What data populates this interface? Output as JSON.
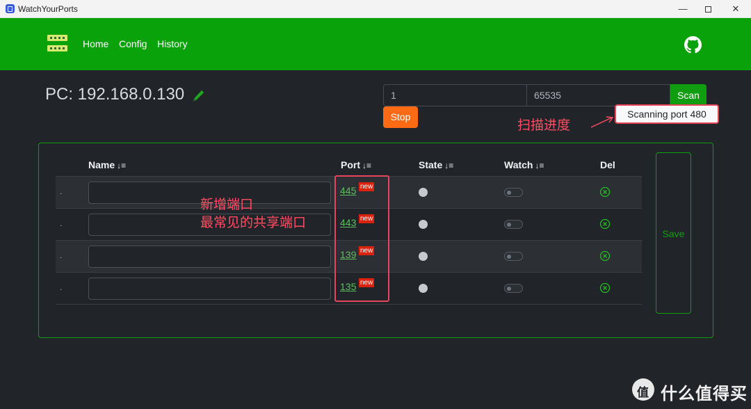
{
  "window": {
    "title": "WatchYourPorts",
    "controls": {
      "minimize": "—",
      "maximize": "",
      "close": "✕"
    }
  },
  "nav": {
    "links": [
      "Home",
      "Config",
      "History"
    ],
    "github_icon": "github-icon"
  },
  "pc": {
    "title": "PC: 192.168.0.130",
    "edit_icon": "pencil-icon"
  },
  "scan": {
    "start_value": "1",
    "end_value": "65535",
    "scan_label": "Scan",
    "stop_label": "Stop",
    "status": "Scanning port 480"
  },
  "annotations": {
    "progress": "扫描进度",
    "new_ports_line1": "新增端口",
    "new_ports_line2": "最常见的共享端口"
  },
  "table": {
    "headers": {
      "name": "Name",
      "port": "Port",
      "state": "State",
      "watch": "Watch",
      "del": "Del"
    },
    "sort_glyph": "↓≡",
    "rows": [
      {
        "marker": ".",
        "name": "",
        "port": "445",
        "badge": "new",
        "state": "off",
        "watch": false
      },
      {
        "marker": ".",
        "name": "",
        "port": "443",
        "badge": "new",
        "state": "off",
        "watch": false
      },
      {
        "marker": ".",
        "name": "",
        "port": "139",
        "badge": "new",
        "state": "off",
        "watch": false
      },
      {
        "marker": ".",
        "name": "",
        "port": "135",
        "badge": "new",
        "state": "off",
        "watch": false
      }
    ],
    "save_label": "Save"
  },
  "watermark": {
    "text": "什么值得买"
  },
  "colors": {
    "nav": "#0aa20a",
    "accent": "#109e10",
    "stop": "#fd6a14",
    "annotation": "#ff4d63",
    "badge": "#d9230f"
  }
}
